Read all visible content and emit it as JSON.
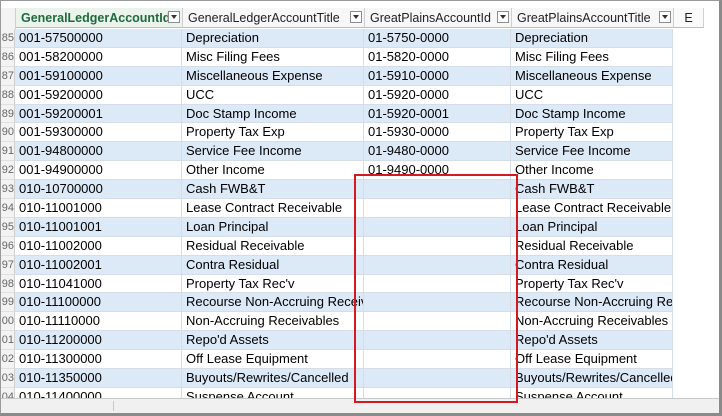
{
  "columns": [
    {
      "label": "GeneralLedgerAccountId"
    },
    {
      "label": "GeneralLedgerAccountTitle"
    },
    {
      "label": "GreatPlainsAccountId"
    },
    {
      "label": "GreatPlainsAccountTitle"
    },
    {
      "label": "E"
    }
  ],
  "rows": [
    {
      "rn": "85",
      "gl_id": "001-57500000",
      "gl_title": "Depreciation",
      "gp_id": "01-5750-0000",
      "gp_title": "Depreciation"
    },
    {
      "rn": "86",
      "gl_id": "001-58200000",
      "gl_title": "Misc Filing Fees",
      "gp_id": "01-5820-0000",
      "gp_title": "Misc Filing Fees"
    },
    {
      "rn": "87",
      "gl_id": "001-59100000",
      "gl_title": "Miscellaneous Expense",
      "gp_id": "01-5910-0000",
      "gp_title": "Miscellaneous Expense"
    },
    {
      "rn": "88",
      "gl_id": "001-59200000",
      "gl_title": "UCC",
      "gp_id": "01-5920-0000",
      "gp_title": "UCC"
    },
    {
      "rn": "89",
      "gl_id": "001-59200001",
      "gl_title": "Doc Stamp Income",
      "gp_id": "01-5920-0001",
      "gp_title": "Doc Stamp Income"
    },
    {
      "rn": "90",
      "gl_id": "001-59300000",
      "gl_title": "Property Tax Exp",
      "gp_id": "01-5930-0000",
      "gp_title": "Property Tax Exp"
    },
    {
      "rn": "91",
      "gl_id": "001-94800000",
      "gl_title": "Service Fee Income",
      "gp_id": "01-9480-0000",
      "gp_title": "Service Fee Income"
    },
    {
      "rn": "92",
      "gl_id": "001-94900000",
      "gl_title": "Other Income",
      "gp_id": "01-9490-0000",
      "gp_title": "Other Income"
    },
    {
      "rn": "93",
      "gl_id": "010-10700000",
      "gl_title": "Cash FWB&T",
      "gp_id": "",
      "gp_title": "Cash FWB&T"
    },
    {
      "rn": "94",
      "gl_id": "010-11001000",
      "gl_title": "Lease Contract Receivable",
      "gp_id": "",
      "gp_title": "Lease Contract Receivable"
    },
    {
      "rn": "95",
      "gl_id": "010-11001001",
      "gl_title": "Loan Principal",
      "gp_id": "",
      "gp_title": "Loan Principal"
    },
    {
      "rn": "96",
      "gl_id": "010-11002000",
      "gl_title": "Residual Receivable",
      "gp_id": "",
      "gp_title": "Residual Receivable"
    },
    {
      "rn": "97",
      "gl_id": "010-11002001",
      "gl_title": "Contra Residual",
      "gp_id": "",
      "gp_title": "Contra Residual"
    },
    {
      "rn": "98",
      "gl_id": "010-11041000",
      "gl_title": "Property Tax Rec'v",
      "gp_id": "",
      "gp_title": "Property Tax Rec'v"
    },
    {
      "rn": "99",
      "gl_id": "010-11100000",
      "gl_title": "Recourse Non-Accruing Receiv",
      "gp_id": "",
      "gp_title": "Recourse Non-Accruing Receiv"
    },
    {
      "rn": "00",
      "gl_id": "010-11110000",
      "gl_title": "Non-Accruing Receivables",
      "gp_id": "",
      "gp_title": "Non-Accruing Receivables"
    },
    {
      "rn": "01",
      "gl_id": "010-11200000",
      "gl_title": "Repo'd Assets",
      "gp_id": "",
      "gp_title": "Repo'd Assets"
    },
    {
      "rn": "02",
      "gl_id": "010-11300000",
      "gl_title": "Off Lease Equipment",
      "gp_id": "",
      "gp_title": "Off Lease Equipment"
    },
    {
      "rn": "03",
      "gl_id": "010-11350000",
      "gl_title": "Buyouts/Rewrites/Cancelled",
      "gp_id": "",
      "gp_title": "Buyouts/Rewrites/Cancelled"
    },
    {
      "rn": "04",
      "gl_id": "010-11400000",
      "gl_title": "Suspense Account",
      "gp_id": "",
      "gp_title": "Suspense Account"
    }
  ],
  "highlight": {
    "color": "#d11a22"
  }
}
